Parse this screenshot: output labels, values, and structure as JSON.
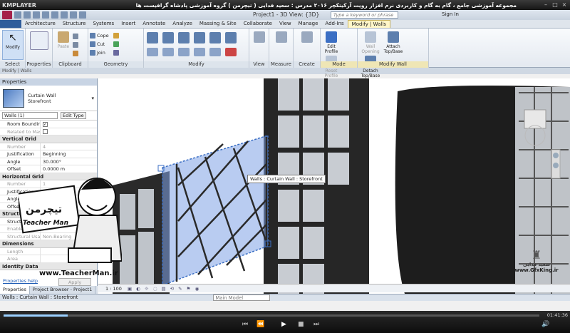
{
  "player": {
    "logo": "KMPLAYER",
    "title": "مجموعه آموزشی جامع ، گام به گام و کاربردی نرم افزار رویت آرکیتکچر ۲۰۱۶ مدرس : سعید فدایی ( تیچرمن ) گروه آموزشی پادشاه گرافیست ها",
    "time": "01:41:36"
  },
  "app": {
    "doc_title": "Project1 - 3D View: {3D}",
    "search_placeholder": "Type a keyword or phrase",
    "signin": "Sign In",
    "tabs": [
      "Architecture",
      "Structure",
      "Systems",
      "Insert",
      "Annotate",
      "Analyze",
      "Massing & Site",
      "Collaborate",
      "View",
      "Manage",
      "Add-Ins",
      "Modify | Walls"
    ],
    "options_bar": "Modify | Walls"
  },
  "ribbon": {
    "select": {
      "title": "Select",
      "modify": "Modify"
    },
    "properties": {
      "title": "Properties"
    },
    "clipboard": {
      "title": "Clipboard",
      "paste": "Paste"
    },
    "geometry": {
      "title": "Geometry",
      "cope": "Cope",
      "cut": "Cut",
      "join": "Join"
    },
    "modify": {
      "title": "Modify"
    },
    "view": {
      "title": "View"
    },
    "measure": {
      "title": "Measure"
    },
    "create": {
      "title": "Create"
    },
    "mode": {
      "title": "Mode",
      "edit_profile": "Edit Profile",
      "reset_profile": "Reset Profile"
    },
    "modify_wall": {
      "title": "Modify Wall",
      "wall_opening": "Wall Opening",
      "attach": "Attach Top/Base",
      "detach": "Detach Top/Base"
    }
  },
  "properties": {
    "header": "Properties",
    "type_line1": "Curtain Wall",
    "type_line2": "Storefront",
    "instance": "Walls (1)",
    "edit_type": "Edit Type",
    "rows": [
      {
        "k": "Room Bounding",
        "v": ""
      },
      {
        "k": "Related to Mass",
        "v": ""
      }
    ],
    "section_vgrid": "Vertical Grid",
    "vgrid": [
      {
        "k": "Number",
        "v": "4"
      },
      {
        "k": "Justification",
        "v": "Beginning"
      },
      {
        "k": "Angle",
        "v": "30.000°"
      },
      {
        "k": "Offset",
        "v": "0.0000 m"
      }
    ],
    "section_hgrid": "Horizontal Grid",
    "hgrid": [
      {
        "k": "Number",
        "v": "1"
      },
      {
        "k": "Justification",
        "v": ""
      },
      {
        "k": "Angle",
        "v": ""
      },
      {
        "k": "Offset",
        "v": ""
      }
    ],
    "section_struct": "Structural",
    "struct": [
      {
        "k": "Structural",
        "v": ""
      },
      {
        "k": "Enable Analy",
        "v": ""
      },
      {
        "k": "Structural Usage",
        "v": "Non-Bearing"
      }
    ],
    "section_dim": "Dimensions",
    "dims": [
      {
        "k": "Length",
        "v": ""
      },
      {
        "k": "Area",
        "v": ""
      }
    ],
    "section_id": "Identity Data",
    "help": "Properties help",
    "apply": "Apply",
    "tab_props": "Properties",
    "tab_browser": "Project Browser - Project1"
  },
  "viewport": {
    "tooltip": "Walls : Curtain Wall : Storefront",
    "scale": "1 : 100"
  },
  "status": {
    "text": "Walls : Curtain Wall : Storefront",
    "model": "Main Model"
  },
  "watermark": {
    "brand_fa": "تیچرمن",
    "brand_en": "Teacher Man",
    "url": "www.TeacherMan.ir",
    "gfx_name": "سعید فدایی",
    "gfx_url": "www.GfxKing.ir"
  },
  "colors": {
    "accent": "#3b6fc4",
    "selection": "#7fa2e6"
  }
}
